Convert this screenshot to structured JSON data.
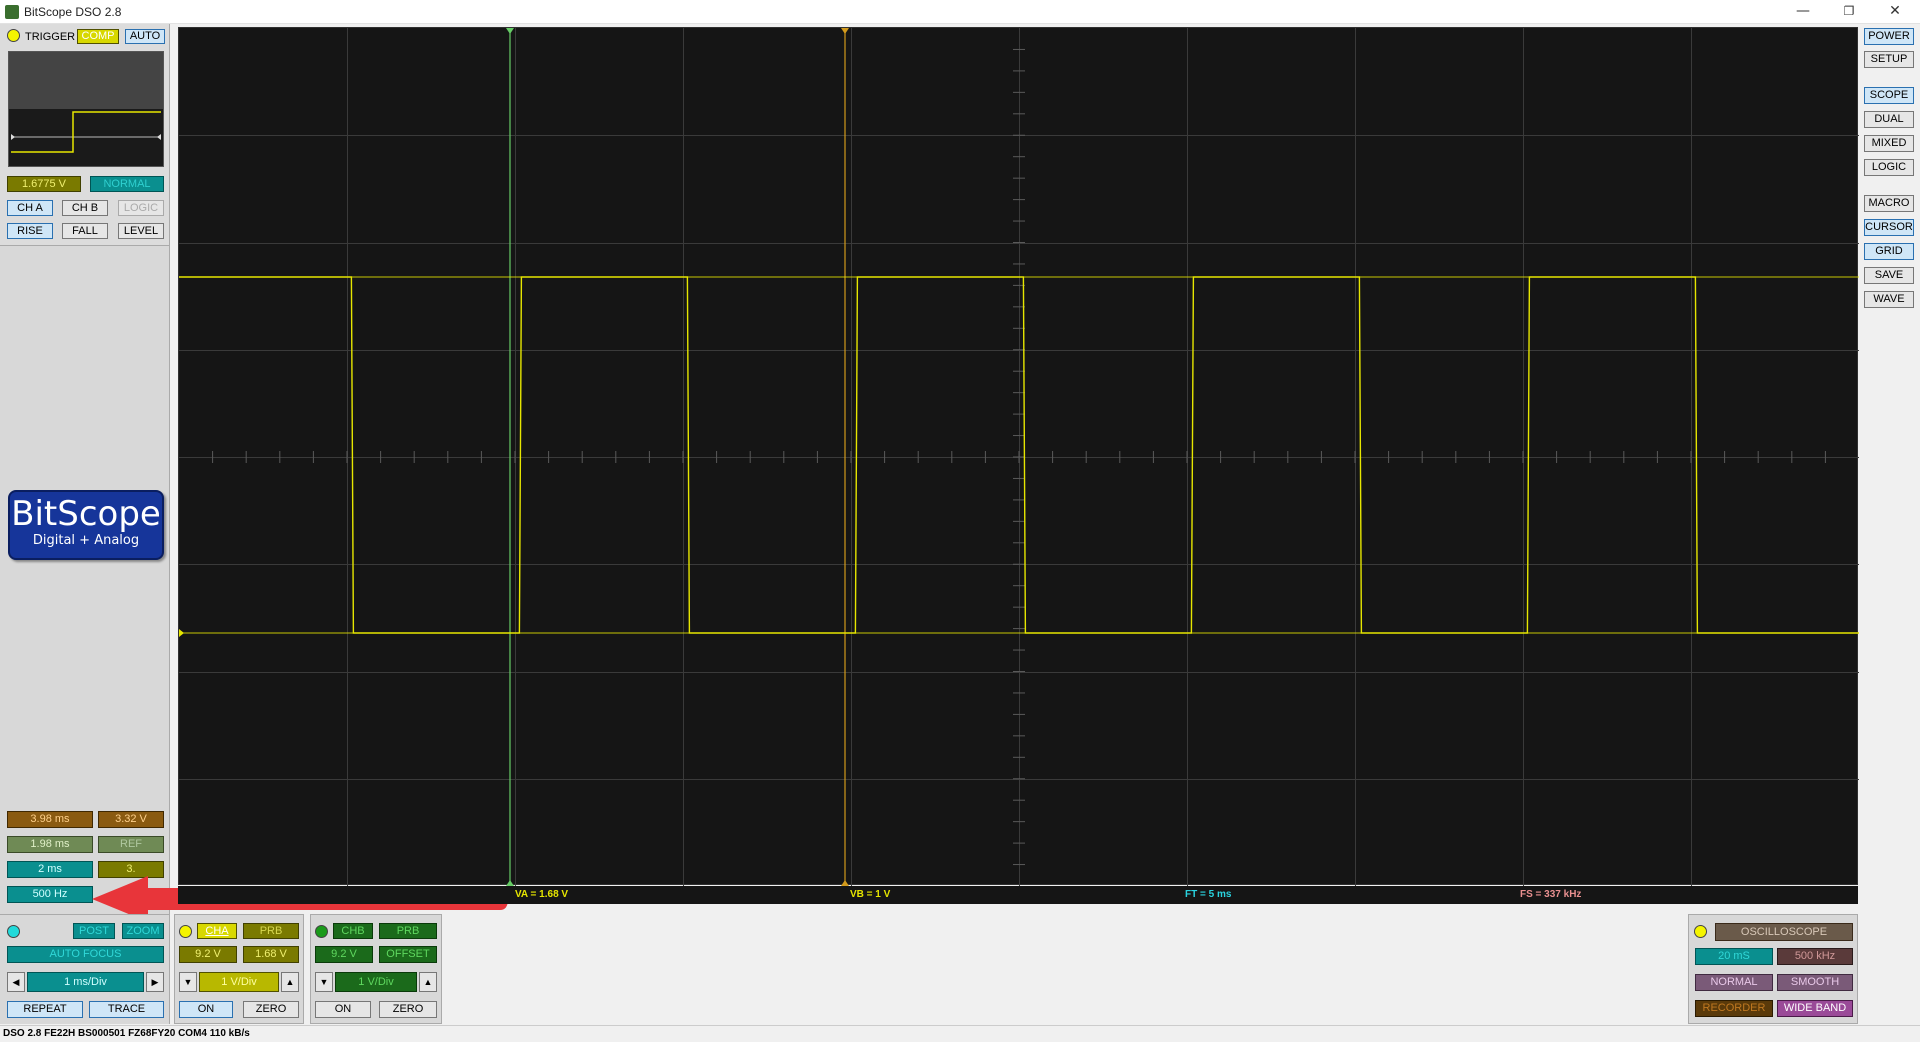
{
  "window": {
    "title": "BitScope DSO 2.8",
    "minimize": "—",
    "restore": "❐",
    "close": "✕"
  },
  "trigger": {
    "label": "TRIGGER",
    "comp": "COMP",
    "auto": "AUTO",
    "level_value": "1.6775 V",
    "mode": "NORMAL",
    "ch_a": "CH A",
    "ch_b": "CH B",
    "logic": "LOGIC",
    "rise": "RISE",
    "fall": "FALL",
    "level": "LEVEL"
  },
  "logo": {
    "main": "BitScope",
    "sub": "Digital + Analog"
  },
  "measurements": {
    "t1": "3.98 ms",
    "v1": "3.32 V",
    "t2": "1.98 ms",
    "ref": "REF",
    "t3": "2 ms",
    "v3": "3.",
    "freq": "500 Hz"
  },
  "timebase": {
    "post": "POST",
    "zoom": "ZOOM",
    "auto_focus": "AUTO FOCUS",
    "rate": "1 ms/Div",
    "left_arrow": "◀",
    "right_arrow": "▶",
    "repeat": "REPEAT",
    "trace": "TRACE"
  },
  "channel_a": {
    "name": "CHA",
    "prb": "PRB",
    "range": "9.2 V",
    "offset": "1.68 V",
    "div": "1 V/Div",
    "down": "▼",
    "up": "▲",
    "on": "ON",
    "zero": "ZERO"
  },
  "channel_b": {
    "name": "CHB",
    "prb": "PRB",
    "range": "9.2 V",
    "offset": "OFFSET",
    "div": "1 V/Div",
    "down": "▼",
    "up": "▲",
    "on": "ON",
    "zero": "ZERO"
  },
  "scope_status": {
    "va": "VA = 1.68 V",
    "vb": "VB = 1 V",
    "ft": "FT = 5 ms",
    "fs": "FS = 337 kHz"
  },
  "acquisition": {
    "mode": "OSCILLOSCOPE",
    "duration": "20 mS",
    "rate": "500 kHz",
    "normal": "NORMAL",
    "smooth": "SMOOTH",
    "recorder": "RECORDER",
    "wide_band": "WIDE BAND"
  },
  "right_panel": {
    "power": "POWER",
    "setup": "SETUP",
    "scope": "SCOPE",
    "dual": "DUAL",
    "mixed": "MIXED",
    "logic": "LOGIC",
    "macro": "MACRO",
    "cursor": "CURSOR",
    "grid": "GRID",
    "save": "SAVE",
    "wave": "WAVE"
  },
  "status_line": "DSO 2.8 FE22H BS000501 FZ68FY20 COM4 110 kB/s",
  "waveform": {
    "frequency_hz": 500,
    "high_v": 3.32,
    "low_v": 0.0,
    "volts_per_div": 1,
    "ms_per_div": 1,
    "trigger_v": 1.68
  },
  "colors": {
    "trace": "#e6e600",
    "grid": "#3a3a3a",
    "cursor_green": "#66cc66",
    "cursor_orange": "#d29a1c"
  }
}
